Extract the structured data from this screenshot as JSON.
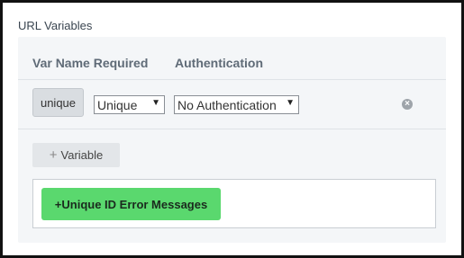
{
  "section": {
    "title": "URL Variables"
  },
  "table": {
    "headers": {
      "var_name": "Var Name",
      "required": "Required",
      "authentication": "Authentication"
    },
    "rows": [
      {
        "name": "unique",
        "required": "Unique",
        "authentication": "No Authentication"
      }
    ]
  },
  "actions": {
    "add_variable_plus": "+",
    "add_variable_label": "Variable",
    "error_messages_label": "+Unique ID Error Messages"
  },
  "icons": {
    "select_caret": "▼",
    "remove": "×"
  },
  "colors": {
    "accent_green": "#5ad86e",
    "panel_bg": "#f4f6f8"
  }
}
